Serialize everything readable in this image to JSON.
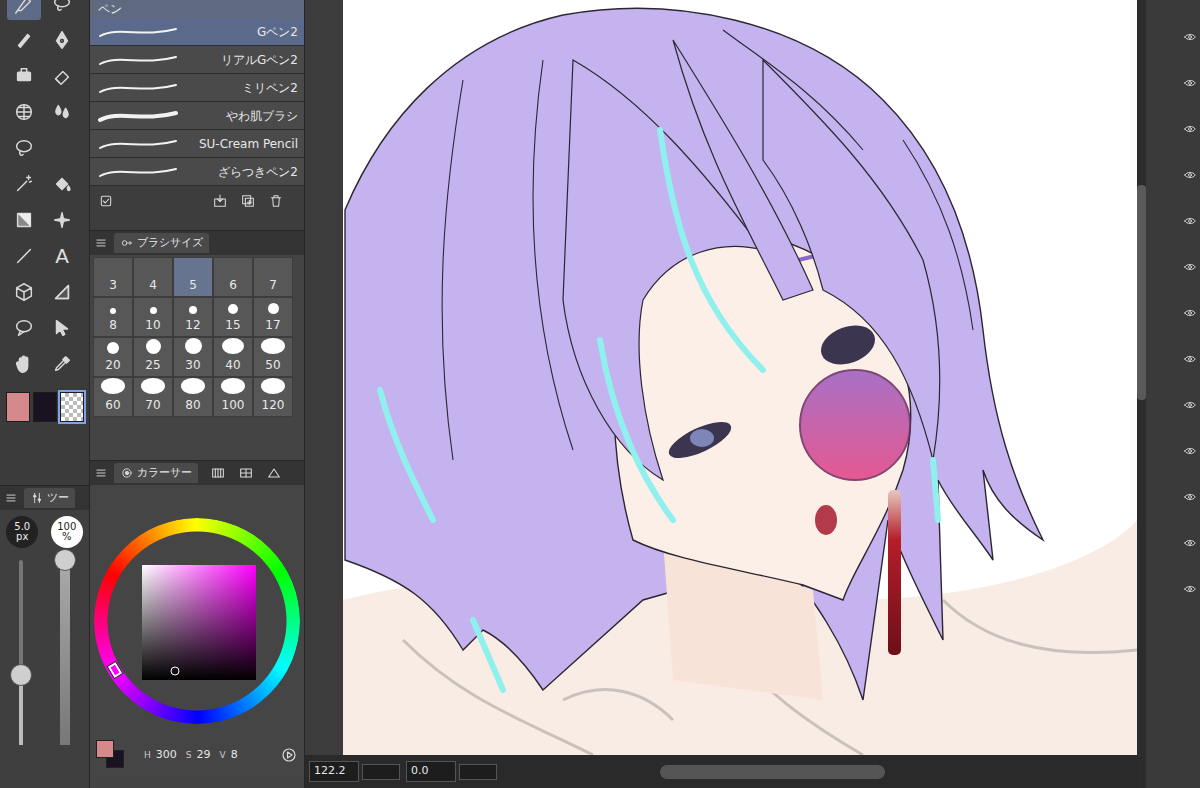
{
  "tools": [
    {
      "kind": "icon",
      "selected": true
    },
    {
      "kind": "icon",
      "selected": false
    },
    {
      "kind": "icon",
      "selected": false
    },
    {
      "kind": "icon",
      "selected": false
    },
    {
      "kind": "icon",
      "selected": false
    },
    {
      "kind": "icon",
      "selected": false
    },
    {
      "kind": "icon",
      "selected": false
    },
    {
      "kind": "icon",
      "selected": false
    },
    {
      "kind": "icon",
      "selected": false
    },
    {
      "kind": "blank",
      "selected": false
    },
    {
      "kind": "icon",
      "selected": false
    },
    {
      "kind": "icon",
      "selected": false
    },
    {
      "kind": "icon",
      "selected": false
    },
    {
      "kind": "icon",
      "selected": false
    },
    {
      "kind": "icon",
      "selected": false
    },
    {
      "kind": "glyph",
      "glyph": "A",
      "selected": false
    },
    {
      "kind": "icon",
      "selected": false
    },
    {
      "kind": "icon",
      "selected": false
    },
    {
      "kind": "icon",
      "selected": false
    },
    {
      "kind": "icon",
      "selected": false
    },
    {
      "kind": "icon",
      "selected": false
    },
    {
      "kind": "icon",
      "selected": false
    }
  ],
  "colors": [
    {
      "kind": "solid",
      "color": "#d48a8a",
      "selected": false
    },
    {
      "kind": "solid",
      "color": "#1a1220",
      "selected": false
    },
    {
      "kind": "transparent",
      "selected": true
    }
  ],
  "brush_list": {
    "group": "ペン",
    "items": [
      {
        "label": "Gペン2",
        "selected": true
      },
      {
        "label": "リアルGペン2",
        "selected": false
      },
      {
        "label": "ミリペン2",
        "selected": false
      },
      {
        "label": "やわ肌ブラシ",
        "selected": false
      },
      {
        "label": "SU-Cream Pencil",
        "selected": false
      },
      {
        "label": "ざらつきペン2",
        "selected": false
      }
    ]
  },
  "brush_size": {
    "title": "ブラシサイズ",
    "sizes": [
      {
        "label": "3",
        "selected": false
      },
      {
        "label": "4",
        "selected": false
      },
      {
        "label": "5",
        "selected": true
      },
      {
        "label": "6",
        "selected": false
      },
      {
        "label": "7",
        "selected": false
      },
      {
        "label": "8",
        "selected": false
      },
      {
        "label": "10",
        "selected": false
      },
      {
        "label": "12",
        "selected": false
      },
      {
        "label": "15",
        "selected": false
      },
      {
        "label": "17",
        "selected": false
      },
      {
        "label": "20",
        "selected": false
      },
      {
        "label": "25",
        "selected": false
      },
      {
        "label": "30",
        "selected": false
      },
      {
        "label": "40",
        "selected": false
      },
      {
        "label": "50",
        "selected": false
      },
      {
        "label": "60",
        "selected": false
      },
      {
        "label": "70",
        "selected": false
      },
      {
        "label": "80",
        "selected": false
      },
      {
        "label": "100",
        "selected": false
      },
      {
        "label": "120",
        "selected": false
      }
    ]
  },
  "tool_property": {
    "tab": "ツー",
    "size": {
      "value": "5.0",
      "unit": "px",
      "level": 0.38
    },
    "opacity": {
      "value": "100",
      "unit": "%",
      "level": 1
    }
  },
  "color_panel": {
    "tab": "カラーサー",
    "hsv": {
      "h_label": "H",
      "h": "300",
      "s_label": "S",
      "s": "29",
      "v_label": "V",
      "v": "8"
    }
  },
  "status_bar": {
    "zoom": "122.2",
    "angle": "0.0"
  }
}
